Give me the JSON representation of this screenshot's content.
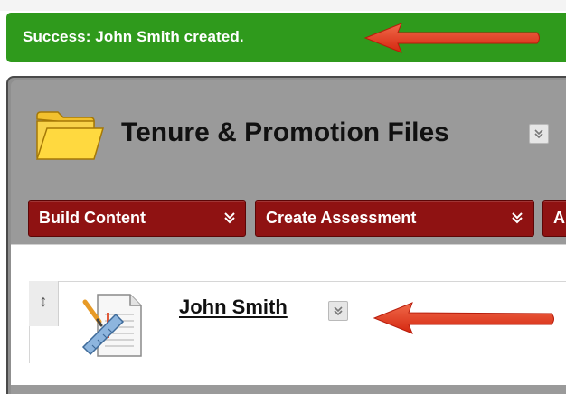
{
  "notification": {
    "message": "Success: John Smith created.",
    "color": "#2f9a1c"
  },
  "header": {
    "title": "Tenure & Promotion Files",
    "folder_icon": "folder-icon",
    "menu_icon": "chevron-down-icon"
  },
  "toolbar": {
    "buttons": [
      {
        "label": "Build Content"
      },
      {
        "label": "Create Assessment"
      },
      {
        "label": "A"
      }
    ],
    "color": "#8f1212"
  },
  "content": {
    "items": [
      {
        "title": "John Smith",
        "icon": "document-icon",
        "drag_glyph": "↕"
      }
    ]
  },
  "annotations": {
    "arrow_color": "#e23a1e"
  }
}
